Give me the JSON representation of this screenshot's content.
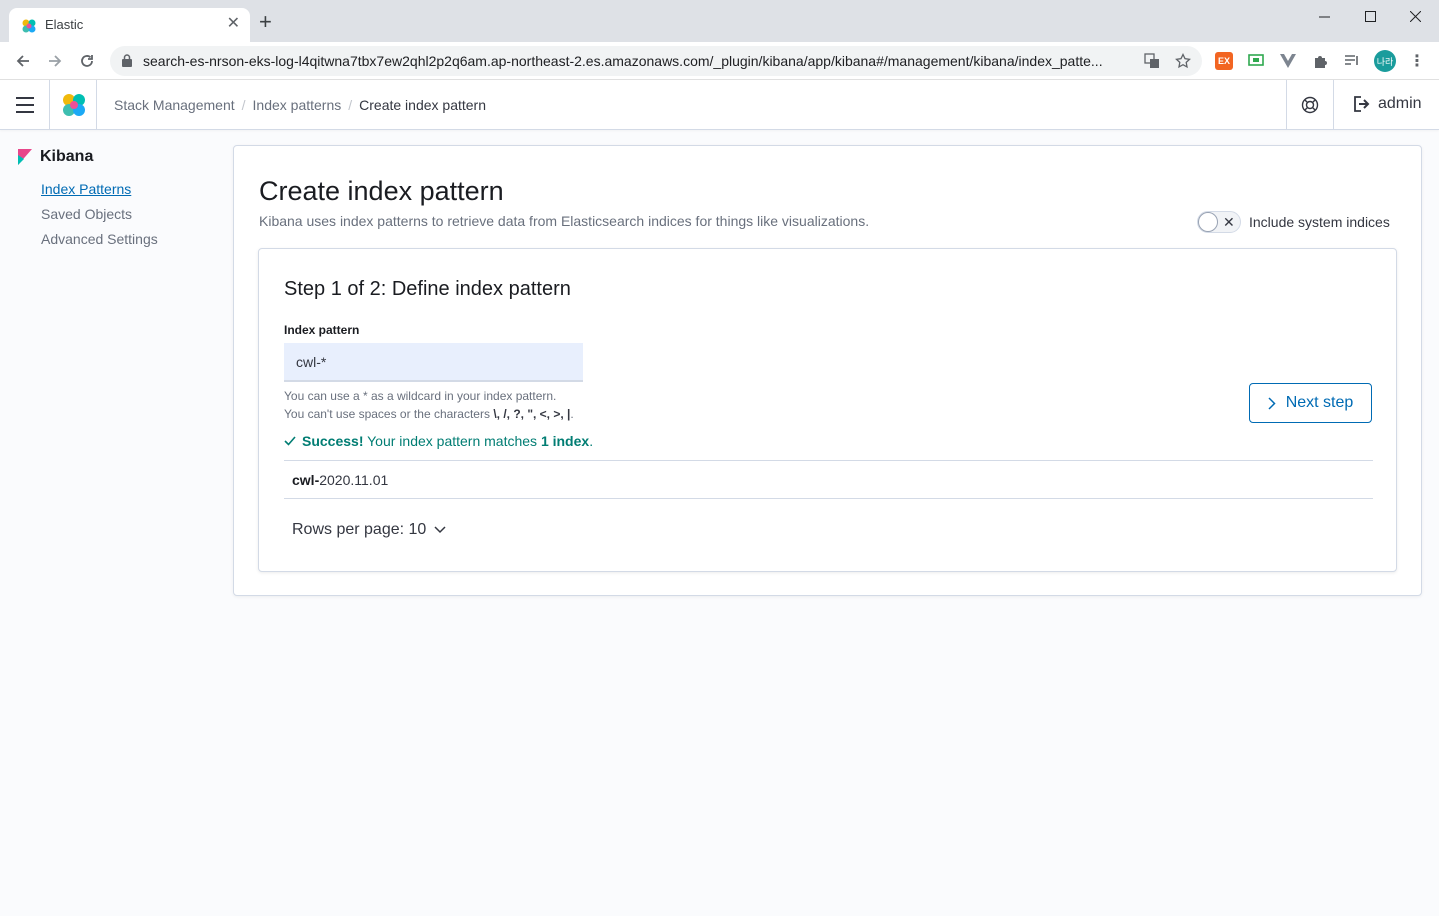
{
  "browser": {
    "tab_title": "Elastic",
    "url": "search-es-nrson-eks-log-l4qitwna7tbx7ew2qhl2p2q6am.ap-northeast-2.es.amazonaws.com/_plugin/kibana/app/kibana#/management/kibana/index_patte...",
    "avatar_text": "나라"
  },
  "header": {
    "breadcrumbs": [
      "Stack Management",
      "Index patterns",
      "Create index pattern"
    ],
    "user": "admin"
  },
  "sidebar": {
    "title": "Kibana",
    "items": [
      {
        "label": "Index Patterns",
        "active": true
      },
      {
        "label": "Saved Objects",
        "active": false
      },
      {
        "label": "Advanced Settings",
        "active": false
      }
    ]
  },
  "main": {
    "title": "Create index pattern",
    "description": "Kibana uses index patterns to retrieve data from Elasticsearch indices for things like visualizations.",
    "system_indices_label": "Include system indices",
    "system_indices_enabled": false,
    "step": {
      "title": "Step 1 of 2: Define index pattern",
      "field_label": "Index pattern",
      "field_value": "cwl-*",
      "help_line1": "You can use a * as a wildcard in your index pattern.",
      "help_line2_prefix": "You can't use spaces or the characters ",
      "help_line2_chars": "\\, /, ?, \", <, >, |",
      "help_line2_suffix": ".",
      "success_bold": "Success!",
      "success_text": " Your index pattern matches ",
      "success_count": "1 index",
      "success_end": ".",
      "index_match_bold": "cwl-",
      "index_match_rest": "2020.11.01",
      "rows_per_page": "Rows per page: 10",
      "next_button": "Next step"
    }
  }
}
